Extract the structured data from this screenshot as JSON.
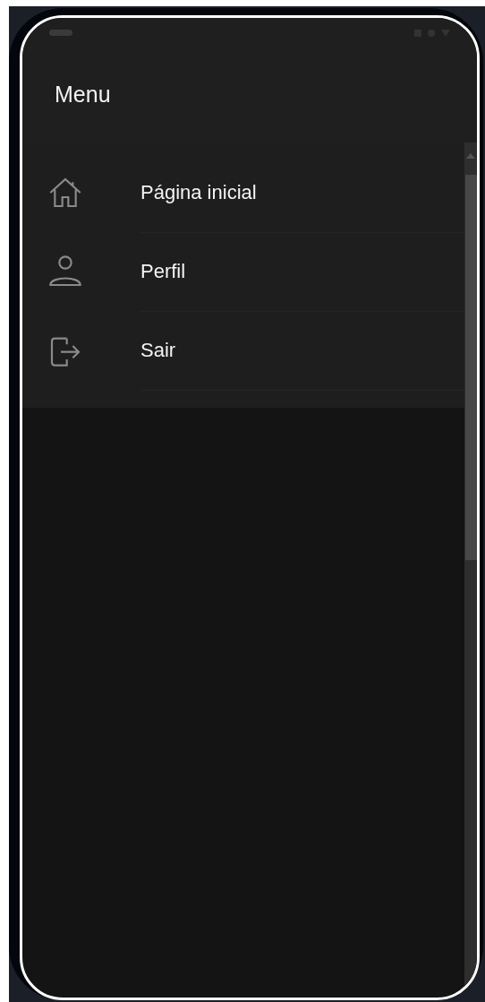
{
  "header": {
    "title": "Menu"
  },
  "menu": [
    {
      "kind": "home",
      "label": "Página inicial"
    },
    {
      "kind": "profile",
      "label": "Perfil"
    },
    {
      "kind": "logout",
      "label": "Sair"
    }
  ]
}
